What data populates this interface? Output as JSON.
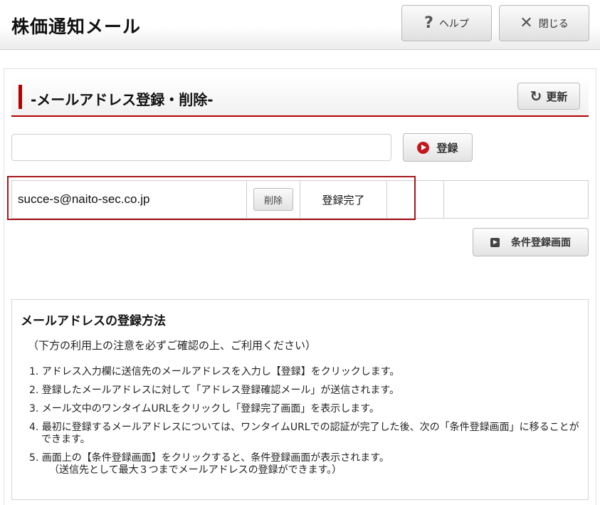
{
  "header": {
    "title": "株価通知メール",
    "help_label": "ヘルプ",
    "close_label": "閉じる"
  },
  "section": {
    "title": "-メールアドレス登録・削除-",
    "refresh_label": "更新"
  },
  "form": {
    "email_value": "",
    "email_placeholder": "",
    "register_label": "登録"
  },
  "addresses": [
    {
      "email": "succe-s@naito-sec.co.jp",
      "delete_label": "削除",
      "status": "登録完了"
    }
  ],
  "condition_button_label": "条件登録画面",
  "instructions": {
    "title": "メールアドレスの登録方法",
    "note": "（下方の利用上の注意を必ずご確認の上、ご利用ください）",
    "steps": [
      "1. アドレス入力欄に送信先のメールアドレスを入力し【登録】をクリックします。",
      "2. 登録したメールアドレスに対して「アドレス登録確認メール」が送信されます。",
      "3. メール文中のワンタイムURLをクリックし「登録完了画面」を表示します。",
      "4. 最初に登録するメールアドレスについては、ワンタイムURLでの認証が完了した後、次の「条件登録画面」に移ることができます。",
      "5. 画面上の【条件登録画面】をクリックすると、条件登録画面が表示されます。"
    ],
    "step5_sub": "（送信先として最大３つまでメールアドレスの登録ができます。）"
  },
  "colors": {
    "accent": "#b30000",
    "highlight_border": "#a8161a",
    "register_icon": "#c4161c"
  }
}
